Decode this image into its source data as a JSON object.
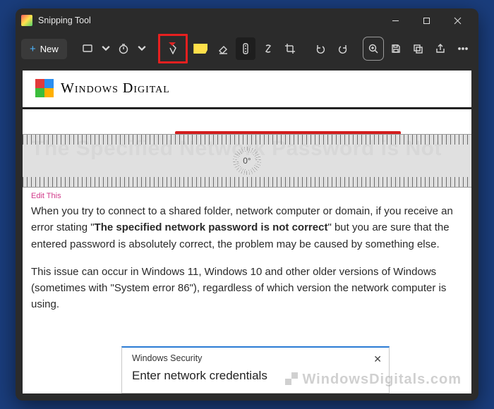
{
  "window": {
    "title": "Snipping Tool"
  },
  "toolbar": {
    "new_label": "New"
  },
  "ruler": {
    "angle": "0°"
  },
  "content": {
    "site_name_1": "Windows",
    "site_name_2": " Digital",
    "headline": "The Specified Network Password is Not",
    "edit_tag": "Edit This",
    "para1_a": "When you try to connect to a shared folder, network computer or domain, if you receive an error stating \"",
    "para1_bold": "The specified network password is not correct",
    "para1_b": "\" but you are sure that the entered password is absolutely correct, the problem may be caused by something else.",
    "para2": "This issue can occur in Windows 11, Windows 10 and other older versions of Windows (sometimes with \"System error 86\"), regardless of which version the network computer is using."
  },
  "dialog": {
    "title": "Windows Security",
    "heading": "Enter network credentials"
  },
  "watermark": "WindowsDigitals.com"
}
